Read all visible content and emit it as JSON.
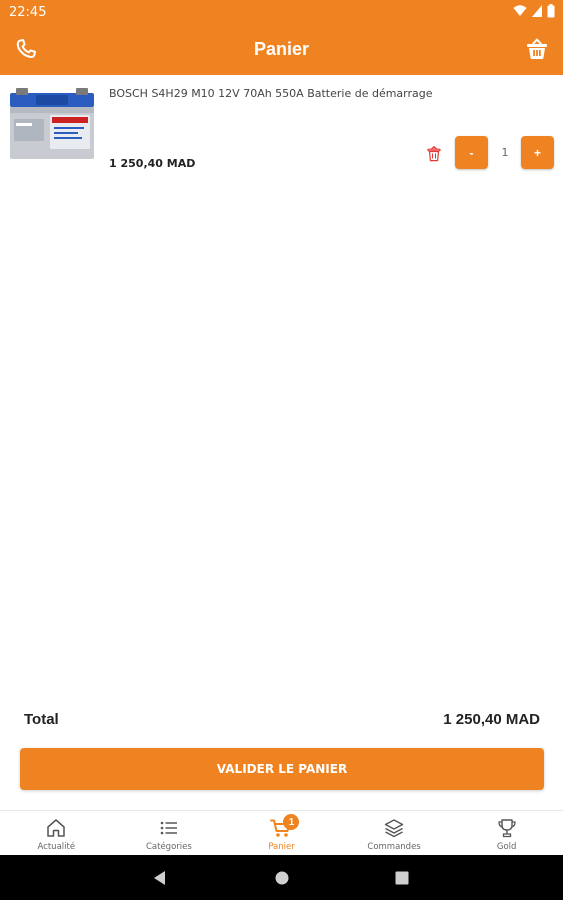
{
  "status_bar": {
    "time": "22:45"
  },
  "app_bar": {
    "title": "Panier"
  },
  "cart_items": [
    {
      "name": "BOSCH S4H29 M10 12V 70Ah 550A Batterie de démarrage",
      "price": "1 250,40 MAD",
      "quantity": "1",
      "minus_label": "-",
      "plus_label": "+",
      "image_icon": "car-battery-image"
    }
  ],
  "summary": {
    "total_label": "Total",
    "total_value": "1 250,40 MAD"
  },
  "validate_button": {
    "label": "VALIDER LE PANIER"
  },
  "bottom_nav": {
    "items": [
      {
        "label": "Actualité",
        "icon": "home-icon"
      },
      {
        "label": "Catégories",
        "icon": "list-icon"
      },
      {
        "label": "Panier",
        "icon": "cart-icon",
        "badge": "1",
        "active": true
      },
      {
        "label": "Commandes",
        "icon": "layers-icon"
      },
      {
        "label": "Gold",
        "icon": "trophy-icon"
      }
    ]
  },
  "colors": {
    "accent": "#f08321",
    "text": "#222222",
    "muted": "#666666"
  }
}
